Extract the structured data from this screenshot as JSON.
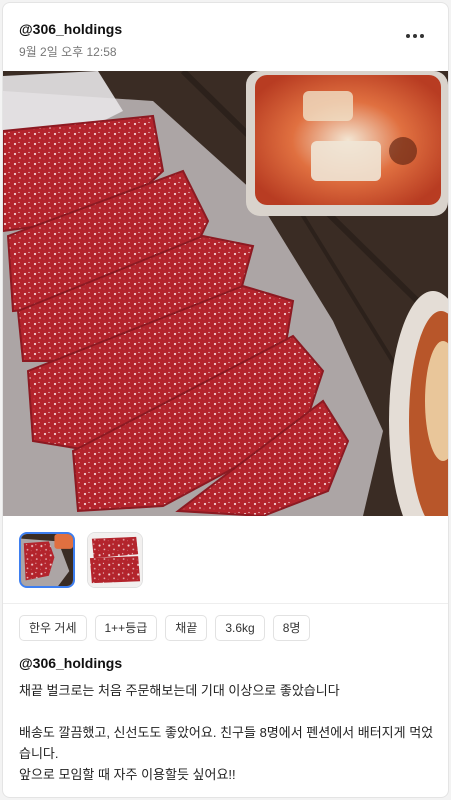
{
  "post": {
    "username": "@306_holdings",
    "date": "9월 2일 오후 12:58",
    "more_icon": "more-horizontal-icon"
  },
  "tags": [
    "한우 거세",
    "1++등급",
    "채끝",
    "3.6kg",
    "8명"
  ],
  "content": {
    "author": "@306_holdings",
    "line1": "채끝 벌크로는 처음 주문해보는데 기대 이상으로 좋았습니다",
    "line2": "배송도 깔끔했고, 신선도도 좋았어요. 친구들 8명에서 펜션에서 배터지게 먹었습니다.",
    "line3": "앞으로 모임할 때 자주 이용할듯 싶어요!!"
  },
  "colors": {
    "selected_thumb_border": "#3d7ef0",
    "meat": "#b3242c",
    "table": "#3a2c24"
  }
}
